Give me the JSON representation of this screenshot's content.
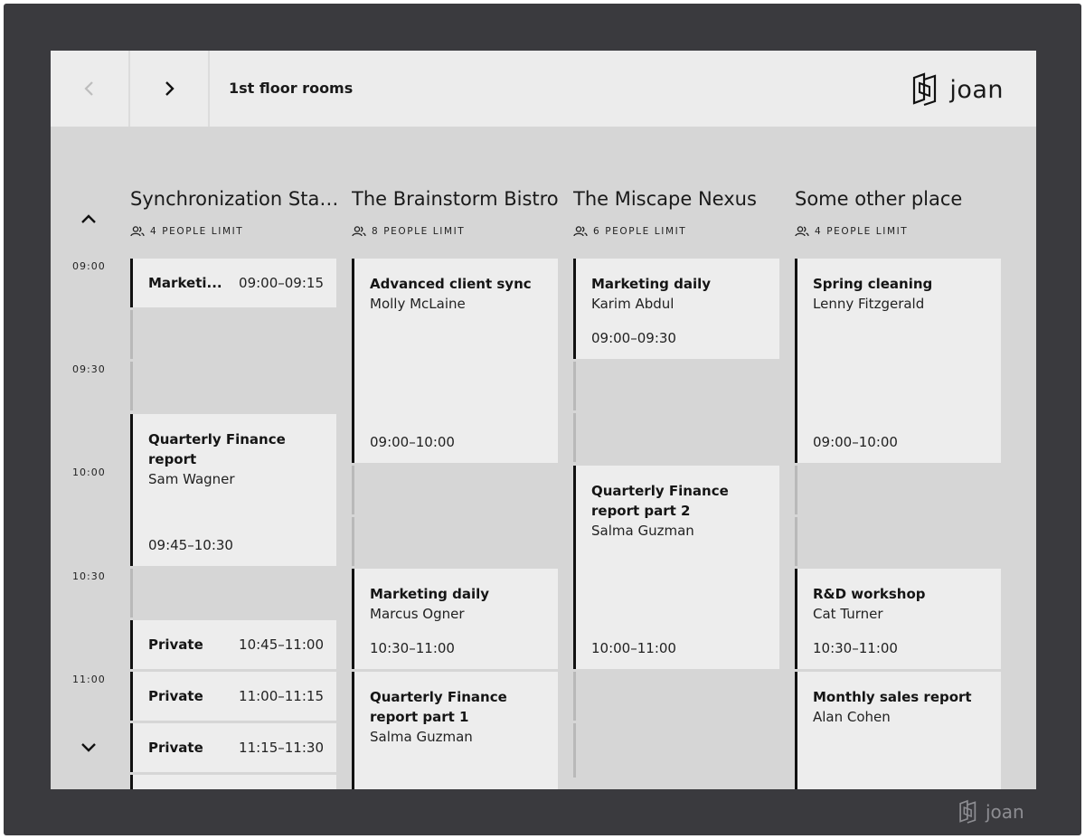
{
  "header": {
    "title": "1st floor rooms",
    "brand": "joan"
  },
  "footer": {
    "brand": "joan"
  },
  "timeline": {
    "labels": [
      "09:00",
      "09:30",
      "10:00",
      "10:30",
      "11:00"
    ]
  },
  "rooms": [
    {
      "name": "Synchronization Stat...",
      "capacity": "4 PEOPLE LIMIT",
      "events": [
        {
          "title": "Marketi...",
          "time": "09:00–09:15"
        },
        {
          "title": "Quarterly Finance report",
          "person": "Sam Wagner",
          "time": "09:45–10:30"
        },
        {
          "title": "Private",
          "time": "10:45–11:00"
        },
        {
          "title": "Private",
          "time": "11:00–11:15"
        },
        {
          "title": "Private",
          "time": "11:15–11:30"
        }
      ]
    },
    {
      "name": "The Brainstorm Bistro",
      "capacity": "8 PEOPLE LIMIT",
      "events": [
        {
          "title": "Advanced client sync",
          "person": "Molly McLaine",
          "time": "09:00–10:00"
        },
        {
          "title": "Marketing daily",
          "person": "Marcus Ogner",
          "time": "10:30–11:00"
        },
        {
          "title": "Quarterly Finance report part 1",
          "person": "Salma Guzman"
        }
      ]
    },
    {
      "name": "The Miscape Nexus",
      "capacity": "6 PEOPLE LIMIT",
      "events": [
        {
          "title": "Marketing daily",
          "person": "Karim Abdul",
          "time": "09:00–09:30"
        },
        {
          "title": "Quarterly Finance report part 2",
          "person": "Salma Guzman",
          "time": "10:00–11:00"
        }
      ]
    },
    {
      "name": "Some other place",
      "capacity": "4 PEOPLE LIMIT",
      "events": [
        {
          "title": "Spring cleaning",
          "person": "Lenny Fitzgerald",
          "time": "09:00–10:00"
        },
        {
          "title": "R&D workshop",
          "person": "Cat Turner",
          "time": "10:30–11:00"
        },
        {
          "title": "Monthly sales report",
          "person": "Alan Cohen"
        }
      ]
    }
  ]
}
